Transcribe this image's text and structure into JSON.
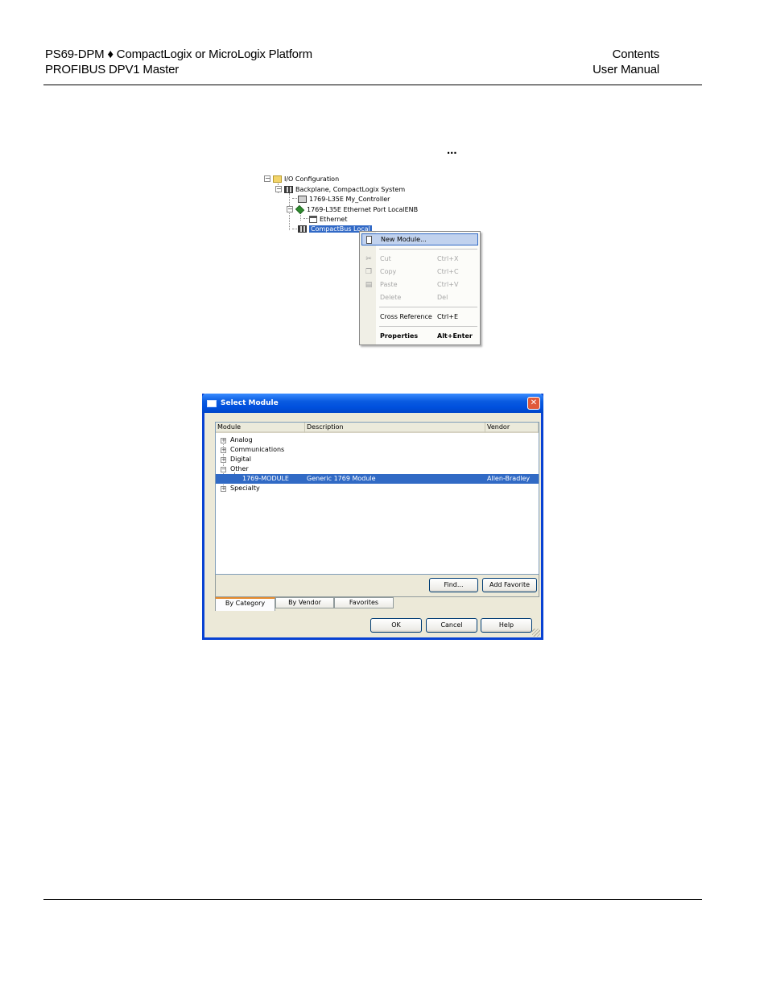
{
  "header": {
    "left_line1": "PS69-DPM ♦ CompactLogix or MicroLogix Platform",
    "left_line2": "PROFIBUS DPV1 Master",
    "right_line1": "Contents",
    "right_line2": "User Manual"
  },
  "ellipsis": "...",
  "tree": {
    "nodes": [
      {
        "label": "I/O Configuration",
        "expander": "−",
        "icon": "folder-icon"
      },
      {
        "label": "Backplane, CompactLogix System",
        "expander": "−",
        "icon": "rack-icon"
      },
      {
        "label": "1769-L35E My_Controller",
        "icon": "controller-icon"
      },
      {
        "label": "1769-L35E Ethernet Port LocalENB",
        "expander": "−",
        "icon": "ethernet-port-icon"
      },
      {
        "label": "Ethernet",
        "icon": "network-icon"
      },
      {
        "label": "CompactBus Local",
        "icon": "rack-icon",
        "selected": true
      }
    ]
  },
  "context_menu": {
    "items": [
      {
        "label": "New Module...",
        "shortcut": "",
        "icon": "new-module-icon",
        "highlighted": true
      },
      {
        "label": "Cut",
        "shortcut": "Ctrl+X",
        "icon": "cut-icon",
        "disabled": true
      },
      {
        "label": "Copy",
        "shortcut": "Ctrl+C",
        "icon": "copy-icon",
        "disabled": true
      },
      {
        "label": "Paste",
        "shortcut": "Ctrl+V",
        "icon": "paste-icon",
        "disabled": true
      },
      {
        "label": "Delete",
        "shortcut": "Del",
        "disabled": true
      },
      {
        "label": "Cross Reference",
        "shortcut": "Ctrl+E"
      },
      {
        "label": "Properties",
        "shortcut": "Alt+Enter",
        "bold": true
      }
    ]
  },
  "dialog": {
    "title": "Select Module",
    "columns": [
      "Module",
      "Description",
      "Vendor"
    ],
    "rows": [
      {
        "module": "Analog",
        "description": "",
        "vendor": "",
        "expander": "+"
      },
      {
        "module": "Communications",
        "description": "",
        "vendor": "",
        "expander": "+"
      },
      {
        "module": "Digital",
        "description": "",
        "vendor": "",
        "expander": "+"
      },
      {
        "module": "Other",
        "description": "",
        "vendor": "",
        "expander": "−"
      },
      {
        "module": "1769-MODULE",
        "description": "Generic 1769 Module",
        "vendor": "Allen-Bradley",
        "selected": true
      },
      {
        "module": "Specialty",
        "description": "",
        "vendor": "",
        "expander": "+"
      }
    ],
    "find_button": "Find...",
    "add_favorite_button": "Add Favorite",
    "tabs": [
      "By Category",
      "By Vendor",
      "Favorites"
    ],
    "ok_button": "OK",
    "cancel_button": "Cancel",
    "help_button": "Help",
    "close_glyph": "✕"
  }
}
